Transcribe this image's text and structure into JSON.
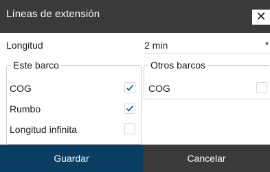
{
  "dialog": {
    "title": "Líneas de extensión",
    "close_icon": "close-icon"
  },
  "length": {
    "label": "Longitud",
    "value": "2 min"
  },
  "this_boat": {
    "legend": "Este barco",
    "items": [
      {
        "label": "COG",
        "checked": true
      },
      {
        "label": "Rumbo",
        "checked": true
      },
      {
        "label": "Longitud infinita",
        "checked": false
      }
    ]
  },
  "other_boats": {
    "legend": "Otros barcos",
    "items": [
      {
        "label": "COG",
        "checked": false
      }
    ]
  },
  "footer": {
    "save_label": "Guardar",
    "cancel_label": "Cancelar"
  },
  "colors": {
    "titlebar": "#3a3a3a",
    "save_button": "#0a3d62",
    "cancel_button": "#3a3a3a",
    "checkmark": "#1a66a8"
  }
}
